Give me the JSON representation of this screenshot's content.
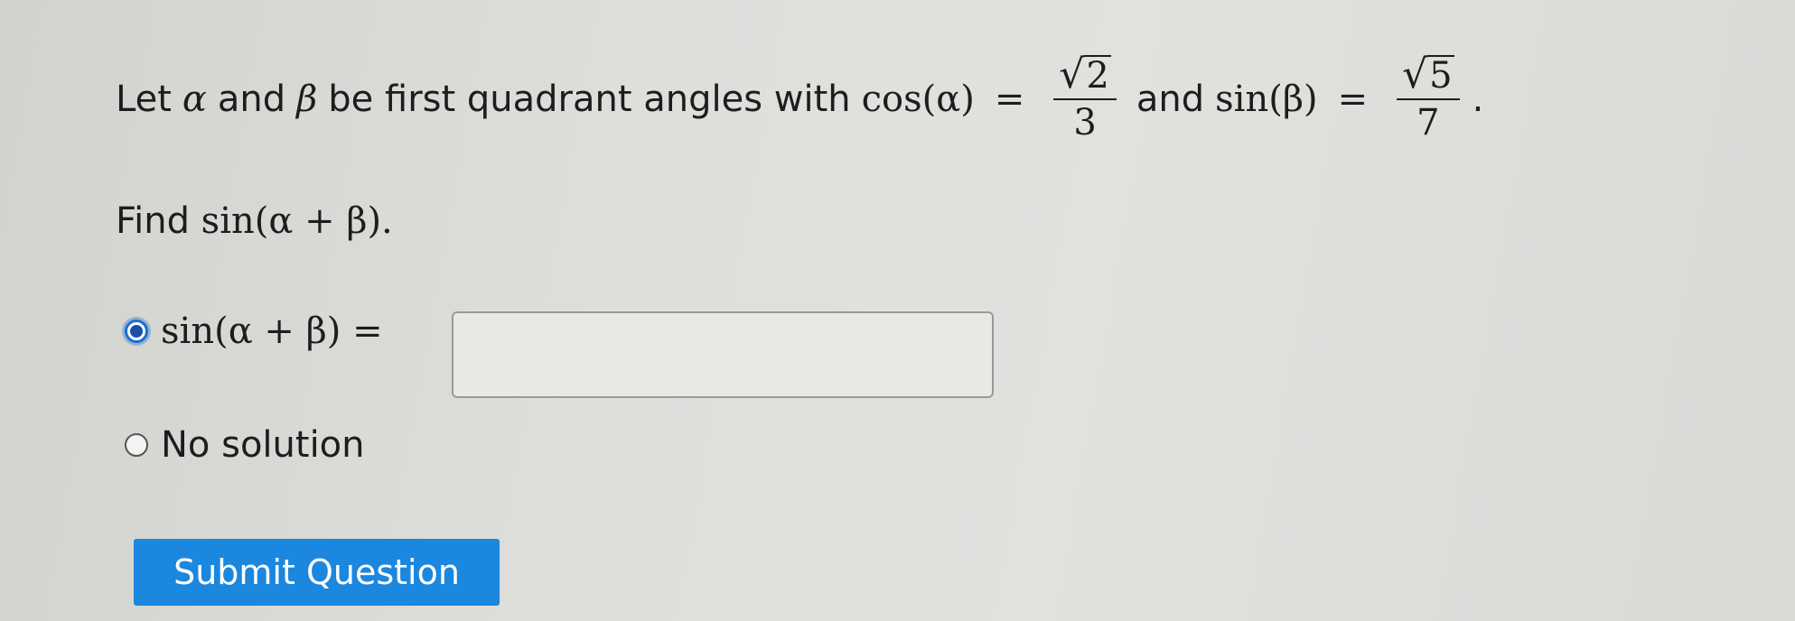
{
  "problem": {
    "intro": "Let",
    "var_alpha": "α",
    "and_word": "and",
    "var_beta": "β",
    "rest": "be first quadrant angles with",
    "cos_expr": "cos(α)",
    "equals": "=",
    "frac1": {
      "radical": "√",
      "radicand": "2",
      "den": "3"
    },
    "and_word2": "and",
    "sin_expr": "sin(β)",
    "frac2": {
      "radical": "√",
      "radicand": "5",
      "den": "7"
    },
    "period": "."
  },
  "find": {
    "label": "Find",
    "expr": "sin(α + β)."
  },
  "options": [
    {
      "label": "sin(α + β) =",
      "selected": true
    },
    {
      "label": "No solution",
      "selected": false
    }
  ],
  "answer_input": {
    "value": ""
  },
  "submit_label": "Submit Question"
}
